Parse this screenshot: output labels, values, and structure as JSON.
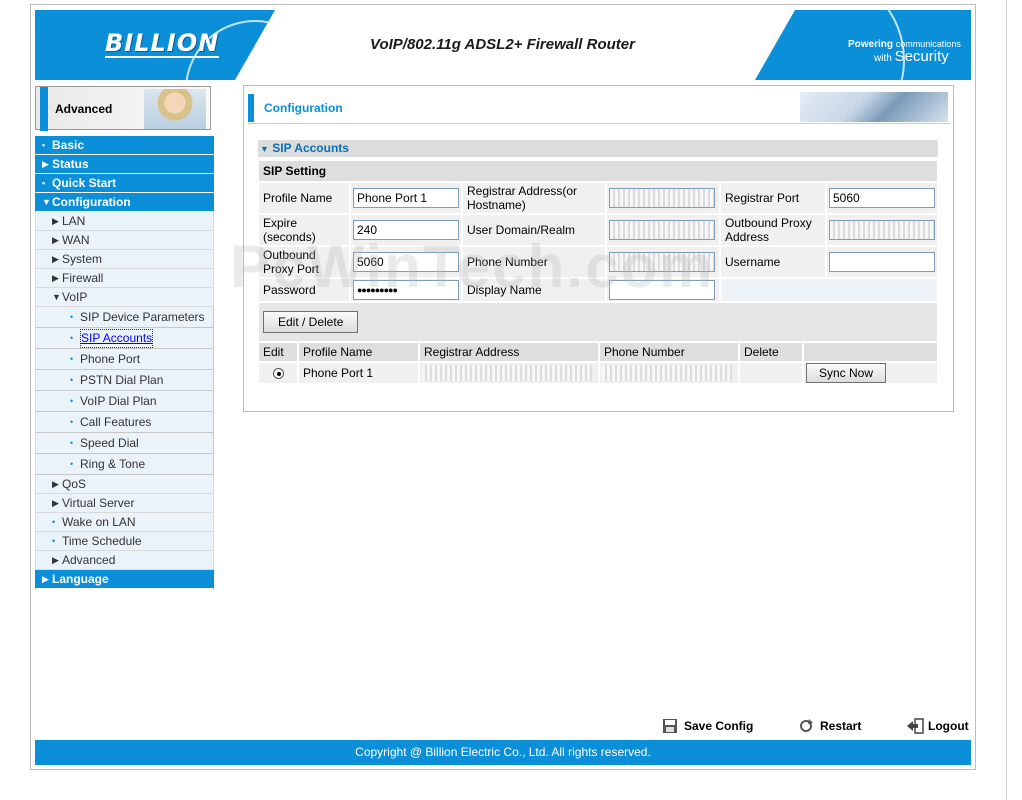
{
  "header": {
    "logo": "BILLION",
    "title": "VoIP/802.11g ADSL2+ Firewall Router",
    "tagline_1": "Powering",
    "tagline_2": "communications",
    "tagline_3": "with",
    "tagline_4": "Security"
  },
  "left": {
    "banner": "Advanced",
    "nav": [
      {
        "label": "Basic",
        "level": "main"
      },
      {
        "label": "Status",
        "level": "main"
      },
      {
        "label": "Quick Start",
        "level": "main"
      },
      {
        "label": "Configuration",
        "level": "main"
      },
      {
        "label": "LAN",
        "level": "sub"
      },
      {
        "label": "WAN",
        "level": "sub"
      },
      {
        "label": "System",
        "level": "sub"
      },
      {
        "label": "Firewall",
        "level": "sub"
      },
      {
        "label": "VoIP",
        "level": "sub"
      },
      {
        "label": "SIP Device Parameters",
        "level": "subsub"
      },
      {
        "label": "SIP Accounts",
        "level": "subsub"
      },
      {
        "label": "Phone Port",
        "level": "subsub"
      },
      {
        "label": "PSTN Dial Plan",
        "level": "subsub"
      },
      {
        "label": "VoIP Dial Plan",
        "level": "subsub"
      },
      {
        "label": "Call Features",
        "level": "subsub"
      },
      {
        "label": "Speed Dial",
        "level": "subsub"
      },
      {
        "label": "Ring & Tone",
        "level": "subsub"
      },
      {
        "label": "QoS",
        "level": "sub"
      },
      {
        "label": "Virtual Server",
        "level": "sub"
      },
      {
        "label": "Wake on LAN",
        "level": "sub"
      },
      {
        "label": "Time Schedule",
        "level": "sub"
      },
      {
        "label": "Advanced",
        "level": "sub"
      },
      {
        "label": "Language",
        "level": "main"
      }
    ]
  },
  "content": {
    "heading": "Configuration",
    "section": "SIP Accounts",
    "setting_title": "SIP Setting",
    "labels": {
      "profile_name": "Profile Name",
      "registrar_address": "Registrar Address(or Hostname)",
      "registrar_port": "Registrar Port",
      "expire": "Expire (seconds)",
      "user_domain": "User Domain/Realm",
      "outbound_proxy_address": "Outbound Proxy Address",
      "outbound_proxy_port": "Outbound Proxy Port",
      "phone_number": "Phone Number",
      "username": "Username",
      "password": "Password",
      "display_name": "Display Name"
    },
    "values": {
      "profile_name": "Phone Port 1",
      "registrar_port": "5060",
      "expire": "240",
      "outbound_proxy_port": "5060",
      "password": "●●●●●●●●●"
    },
    "edit_delete_button": "Edit / Delete",
    "table_headers": [
      "Edit",
      "Profile Name",
      "Registrar Address",
      "Phone Number",
      "Delete",
      ""
    ],
    "table_row": {
      "profile_name": "Phone Port 1",
      "sync_button": "Sync Now"
    }
  },
  "footer": {
    "save_config": "Save Config",
    "restart": "Restart",
    "logout": "Logout",
    "copyright": "Copyright @ Billion Electric Co., Ltd. All rights reserved."
  },
  "watermark": "PcWinTech.com"
}
